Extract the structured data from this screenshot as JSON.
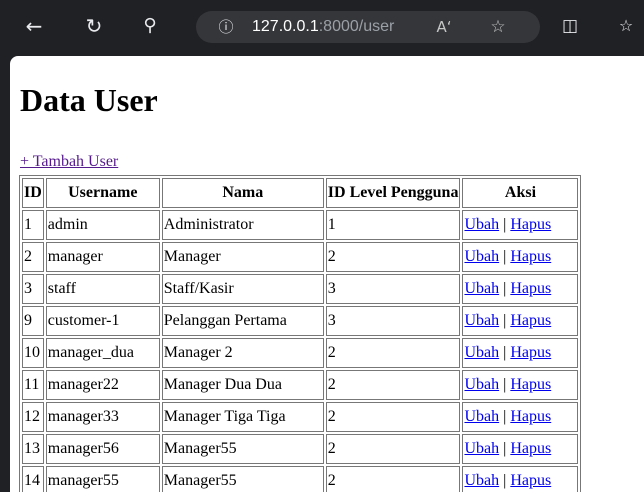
{
  "browser": {
    "url_host": "127.0.0.1",
    "url_path": ":8000/user",
    "icons": [
      "back-icon",
      "reload-icon",
      "search-icon",
      "info-icon",
      "read-aloud-icon",
      "favorite-icon",
      "split-screen-icon",
      "favorites-list-icon"
    ]
  },
  "page": {
    "title": "Data User",
    "add_link": "+ Tambah User"
  },
  "table": {
    "headers": [
      "ID",
      "Username",
      "Nama",
      "ID Level Pengguna",
      "Aksi"
    ],
    "edit_label": "Ubah",
    "sep_label": "|",
    "delete_label": "Hapus",
    "rows": [
      {
        "id": "1",
        "username": "admin",
        "nama": "Administrator",
        "level": "1"
      },
      {
        "id": "2",
        "username": "manager",
        "nama": "Manager",
        "level": "2"
      },
      {
        "id": "3",
        "username": "staff",
        "nama": "Staff/Kasir",
        "level": "3"
      },
      {
        "id": "9",
        "username": "customer-1",
        "nama": "Pelanggan Pertama",
        "level": "3"
      },
      {
        "id": "10",
        "username": "manager_dua",
        "nama": "Manager 2",
        "level": "2"
      },
      {
        "id": "11",
        "username": "manager22",
        "nama": "Manager Dua Dua",
        "level": "2"
      },
      {
        "id": "12",
        "username": "manager33",
        "nama": "Manager Tiga Tiga",
        "level": "2"
      },
      {
        "id": "13",
        "username": "manager56",
        "nama": "Manager55",
        "level": "2"
      },
      {
        "id": "14",
        "username": "manager55",
        "nama": "Manager55",
        "level": "2"
      }
    ]
  }
}
